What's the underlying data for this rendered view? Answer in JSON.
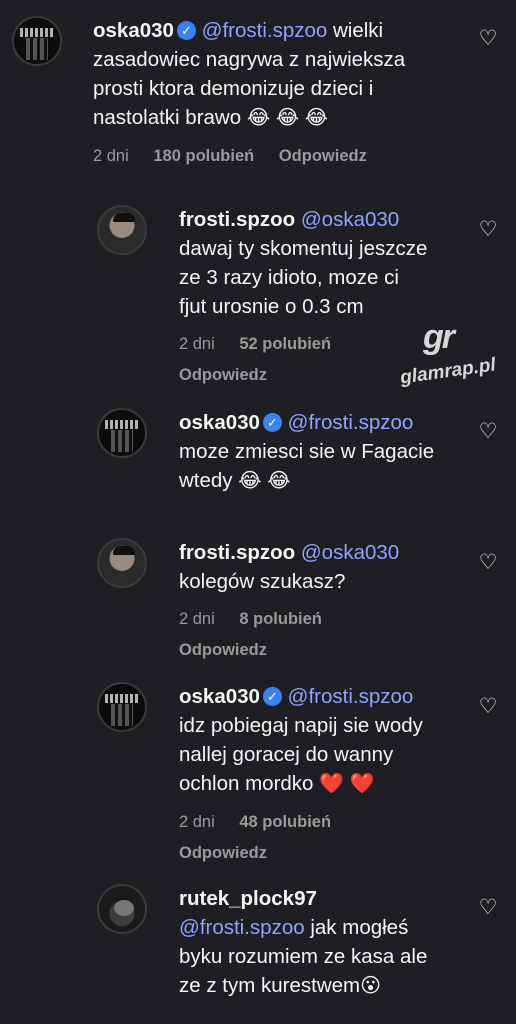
{
  "comments": [
    {
      "username": "oska030",
      "verified": true,
      "mention": "@frosti.spzoo",
      "lines": [
        "wielki",
        "zasadowiec nagrywa z najwieksza",
        "prosti ktora demonizuje dzieci i",
        "nastolatki brawo"
      ],
      "emojis": "😂 😂 😂",
      "time": "2 dni",
      "likes": "180 polubień",
      "reply": "Odpowiedz",
      "avatar_icon": "band-logo-avatar"
    },
    {
      "username": "frosti.spzoo",
      "verified": false,
      "mention": "@oska030",
      "lines": [
        "dawaj ty skomentuj jeszcze",
        "ze 3 razy idioto, moze ci",
        "fjut urosnie o 0.3 cm"
      ],
      "time": "2 dni",
      "likes": "52 polubień",
      "reply": "Odpowiedz"
    },
    {
      "username": "oska030",
      "verified": true,
      "mention": "@frosti.spzoo",
      "lines": [
        "moze zmiesci sie w Fagacie",
        "wtedy"
      ],
      "emojis": "😂 😂"
    },
    {
      "username": "frosti.spzoo",
      "verified": false,
      "mention": "@oska030",
      "lines": [
        "kolegów szukasz?"
      ],
      "time": "2 dni",
      "likes": "8 polubień",
      "reply": "Odpowiedz"
    },
    {
      "username": "oska030",
      "verified": true,
      "mention": "@frosti.spzoo",
      "lines": [
        "idz pobiegaj napij sie wody",
        "nallej goracej do wanny",
        "ochlon mordko"
      ],
      "emojis": "❤️ ❤️",
      "time": "2 dni",
      "likes": "48 polubień",
      "reply": "Odpowiedz"
    },
    {
      "username": "rutek_plock97",
      "verified": false,
      "mention": "@frosti.spzoo",
      "lines": [
        "jak mogłeś",
        "byku rozumiem ze kasa ale",
        "ze z tym kurestwem"
      ],
      "emojis": "😮"
    }
  ],
  "watermark": {
    "logo": "gr",
    "text": "glamrap.pl"
  },
  "icons": {
    "like": "heart-icon",
    "verified": "verified-badge-icon"
  }
}
